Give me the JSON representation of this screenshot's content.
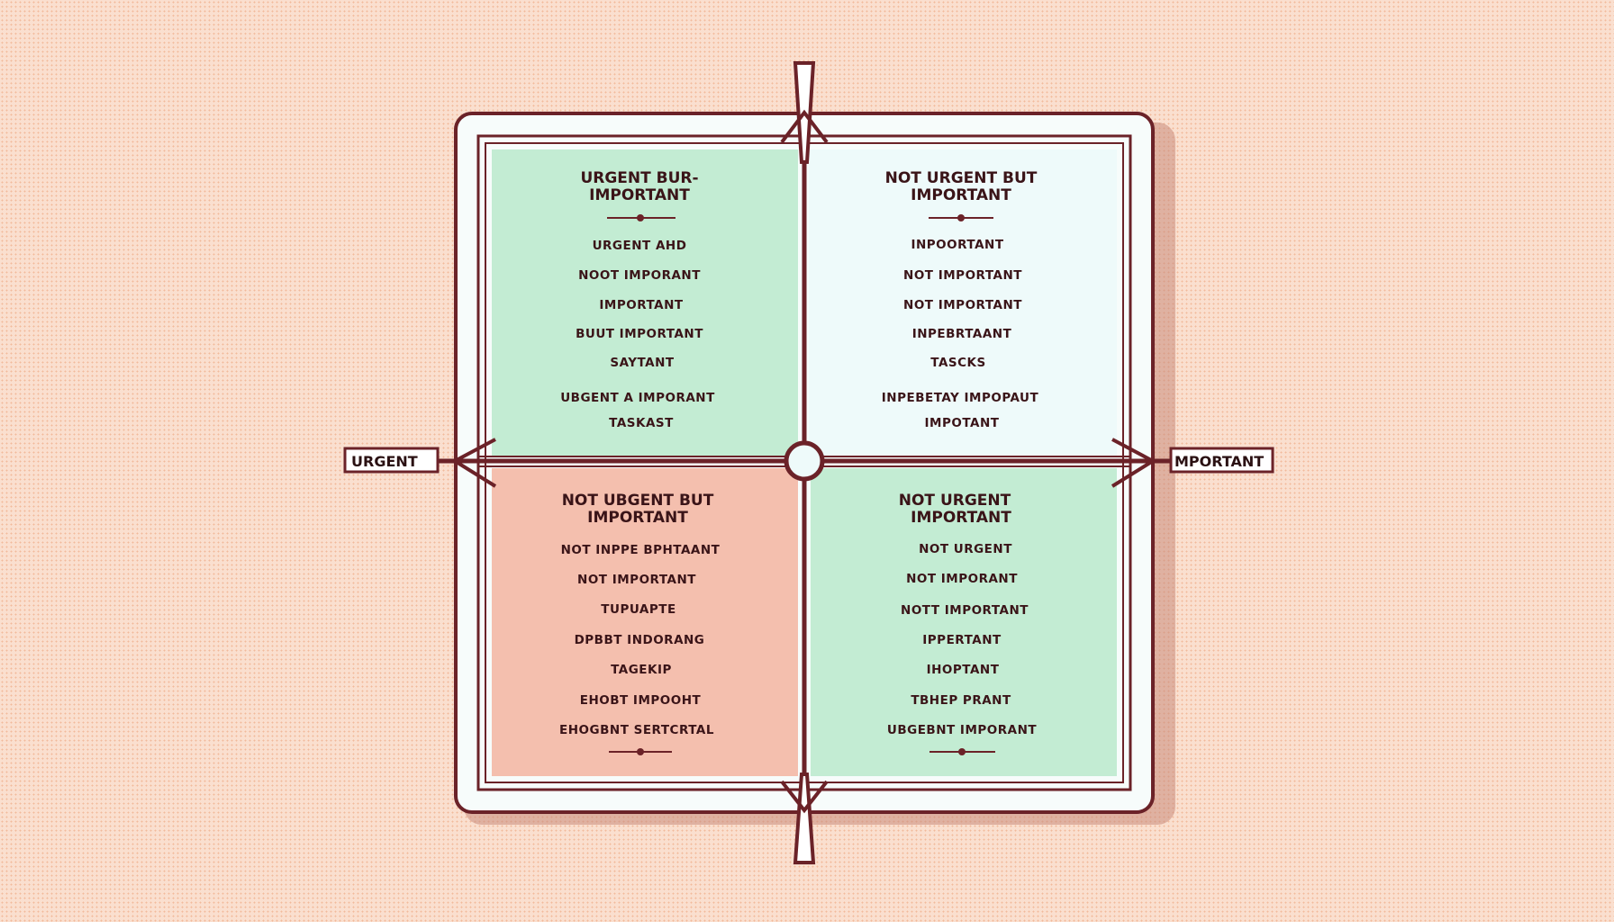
{
  "colors": {
    "frame": "#6b2228",
    "urgent_important": "#c3ecd3",
    "not_urgent_important": "#eefafa",
    "bottom_left": "#f4bfae",
    "bottom_right": "#c3ecd3",
    "background": "#fadfcf"
  },
  "axes": {
    "left_label": "URGENT",
    "right_label": "MPORTANT"
  },
  "quadrants": [
    {
      "title_lines": [
        "URGENT BUR-",
        "IMPORTANT"
      ],
      "items": [
        "URGENT AHD",
        "NOOT IMPORANT",
        "IMPORTANT",
        "BUUT IMPORTANT",
        "SAYTANT",
        "UBGENT A IMPORANT",
        "TASKAST"
      ]
    },
    {
      "title_lines": [
        "NOT URGENT BUT",
        "IMPORTANT"
      ],
      "items": [
        "INPOORTANT",
        "NOT IMPORTANT",
        "NOT IMPORTANT",
        "INPEBRTAANT",
        "TASCKS",
        "INPEBETAY IMPOPAUT",
        "IMPOTANT"
      ]
    },
    {
      "title_lines": [
        "NOT UBGENT BUT",
        "IMPORTANT"
      ],
      "items": [
        "NOT INPPE BPHTAANT",
        "NOT IMPORTANT",
        "TUPUAPTE",
        "DPBBT INDORANG",
        "TAGEKIP",
        "EHOBT IMPOOHT",
        "EHOGBNT SERTCRTAL"
      ]
    },
    {
      "title_lines": [
        "NOT URGENT",
        "IMPORTANT"
      ],
      "items": [
        "NOT URGENT",
        "NOT IMPORANT",
        "NOTT IMPORTANT",
        "IPPERTANT",
        "IHOPTANT",
        "TBHEP PRANT",
        "UBGEBNT IMPORANT"
      ]
    }
  ]
}
